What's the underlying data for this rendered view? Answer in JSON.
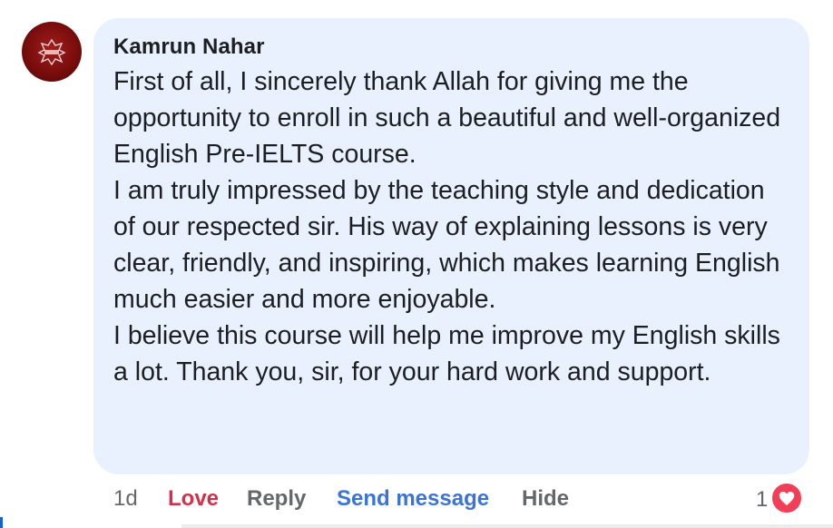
{
  "comment": {
    "author": "Kamrun Nahar",
    "paragraphs": [
      "First of all, I sincerely thank Allah for giving me the opportunity to enroll in such a beautiful and well-organized English Pre-IELTS course.",
      "I am truly impressed by the teaching style and dedication of our respected sir. His way of explaining lessons is very clear, friendly, and inspiring, which makes learning English much easier and more enjoyable.",
      "I believe this course will help me improve my English skills a lot. Thank you, sir, for your hard work and support."
    ]
  },
  "actions": {
    "time": "1d",
    "love": "Love",
    "reply": "Reply",
    "send_message": "Send message",
    "hide": "Hide"
  },
  "reactions": {
    "count": "1",
    "icon": "heart-icon",
    "color": "#f33e58"
  },
  "colors": {
    "bubble": "#e9f1fe",
    "love": "#d0314b",
    "send_message": "#3b74d4",
    "muted": "#65676b",
    "avatar": "#7a0d0d"
  }
}
